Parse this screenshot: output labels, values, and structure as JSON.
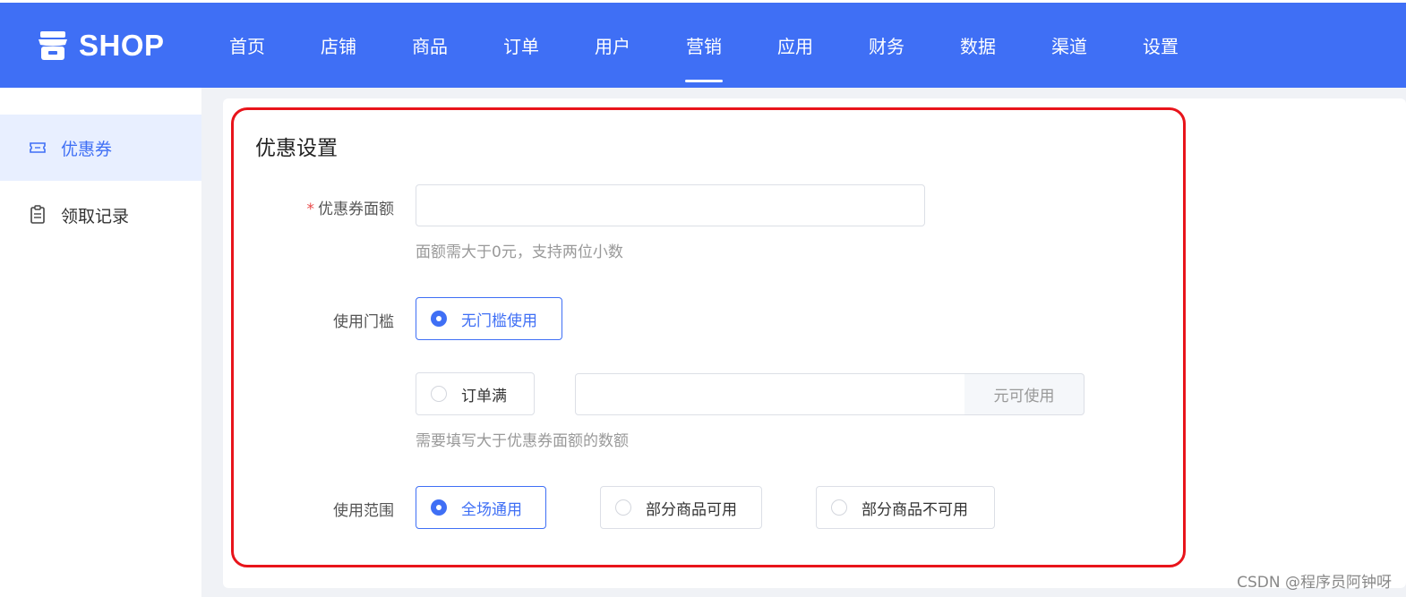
{
  "header": {
    "logo_text": "SHOP",
    "nav": [
      "首页",
      "店铺",
      "商品",
      "订单",
      "用户",
      "营销",
      "应用",
      "财务",
      "数据",
      "渠道",
      "设置"
    ],
    "active_nav": "营销"
  },
  "sidebar": {
    "items": [
      {
        "label": "优惠券",
        "icon": "coupon-icon",
        "active": true
      },
      {
        "label": "领取记录",
        "icon": "clipboard-icon",
        "active": false
      }
    ]
  },
  "form": {
    "title": "优惠设置",
    "face_value": {
      "required_mark": "*",
      "label": "优惠券面额",
      "value": "",
      "hint": "面额需大于0元，支持两位小数"
    },
    "threshold": {
      "label": "使用门槛",
      "option_none": "无门槛使用",
      "option_order": "订单满",
      "order_amount": "",
      "order_suffix": "元可使用",
      "hint": "需要填写大于优惠券面额的数额",
      "selected": "无门槛使用"
    },
    "scope": {
      "label": "使用范围",
      "options": [
        "全场通用",
        "部分商品可用",
        "部分商品不可用"
      ],
      "selected": "全场通用"
    }
  },
  "watermark": "CSDN @程序员阿钟呀",
  "colors": {
    "primary": "#3f6ff5",
    "highlight": "#e8141b",
    "active_bg": "#e8efff"
  }
}
